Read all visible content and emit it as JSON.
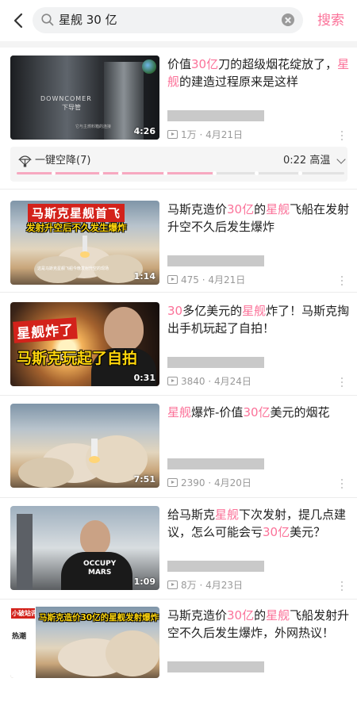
{
  "search": {
    "query": "星舰 30 亿",
    "button_label": "搜索"
  },
  "one_click_landing": {
    "label": "一键空降(7)",
    "time": "0:22 高温",
    "progress": 0.6
  },
  "videos": [
    {
      "title_parts": [
        {
          "text": "价值",
          "hl": false
        },
        {
          "text": "30亿",
          "hl": true
        },
        {
          "text": "刀的超级烟花绽放了，",
          "hl": false
        },
        {
          "text": "星舰",
          "hl": true
        },
        {
          "text": "的建造过程原来是这样",
          "hl": false
        }
      ],
      "duration": "4:26",
      "views": "1万",
      "date": "4月21日",
      "thumb_text": "DOWNCOMER",
      "thumb_subtext": "下导管",
      "thumb_footnote": "它与主燃料箱的连接"
    },
    {
      "title_parts": [
        {
          "text": "马斯克造价",
          "hl": false
        },
        {
          "text": "30亿",
          "hl": true
        },
        {
          "text": "的",
          "hl": false
        },
        {
          "text": "星舰",
          "hl": true
        },
        {
          "text": "飞船在发射升空不久后发生爆炸",
          "hl": false
        }
      ],
      "duration": "1:14",
      "views": "475",
      "date": "4月21日",
      "thumb_caption1": "马斯克星舰首飞",
      "thumb_caption2": "发射升空后不久发生爆炸",
      "thumb_footnote": "这是马斯克星舰飞船今晚发射升空的现场"
    },
    {
      "title_parts": [
        {
          "text": "30",
          "hl": true
        },
        {
          "text": "多亿美元的",
          "hl": false
        },
        {
          "text": "星舰",
          "hl": true
        },
        {
          "text": "炸了！马斯克掏出手机玩起了自拍！",
          "hl": false
        }
      ],
      "duration": "0:31",
      "views": "3840",
      "date": "4月24日",
      "thumb_caption1": "星舰炸了",
      "thumb_caption2": "马斯克玩起了自拍"
    },
    {
      "title_parts": [
        {
          "text": "星舰",
          "hl": true
        },
        {
          "text": "爆炸-价值",
          "hl": false
        },
        {
          "text": "30亿",
          "hl": true
        },
        {
          "text": "美元的烟花",
          "hl": false
        }
      ],
      "duration": "7:51",
      "views": "2390",
      "date": "4月20日"
    },
    {
      "title_parts": [
        {
          "text": "给马斯克",
          "hl": false
        },
        {
          "text": "星舰",
          "hl": true
        },
        {
          "text": "下次发射，提几点建议，怎么可能会亏",
          "hl": false
        },
        {
          "text": "30亿",
          "hl": true
        },
        {
          "text": "美元？",
          "hl": false
        }
      ],
      "duration": "1:09",
      "views": "8万",
      "date": "4月23日",
      "thumb_shirt_text1": "OCCUPY",
      "thumb_shirt_text2": "MARS"
    },
    {
      "title_parts": [
        {
          "text": "马斯克造价",
          "hl": false
        },
        {
          "text": "30亿",
          "hl": true
        },
        {
          "text": "的",
          "hl": false
        },
        {
          "text": "星舰",
          "hl": true
        },
        {
          "text": "飞船发射升空不久后发生爆炸，外网热议！",
          "hl": false
        }
      ],
      "duration": "",
      "views": "",
      "date": "",
      "thumb_caption1": "马斯克造价30亿的星舰发射爆炸",
      "thumb_badge1": "小破站评区",
      "thumb_badge2": "热潮"
    }
  ],
  "colors": {
    "accent": "#fb7299",
    "text": "#212121",
    "meta": "#999999"
  }
}
